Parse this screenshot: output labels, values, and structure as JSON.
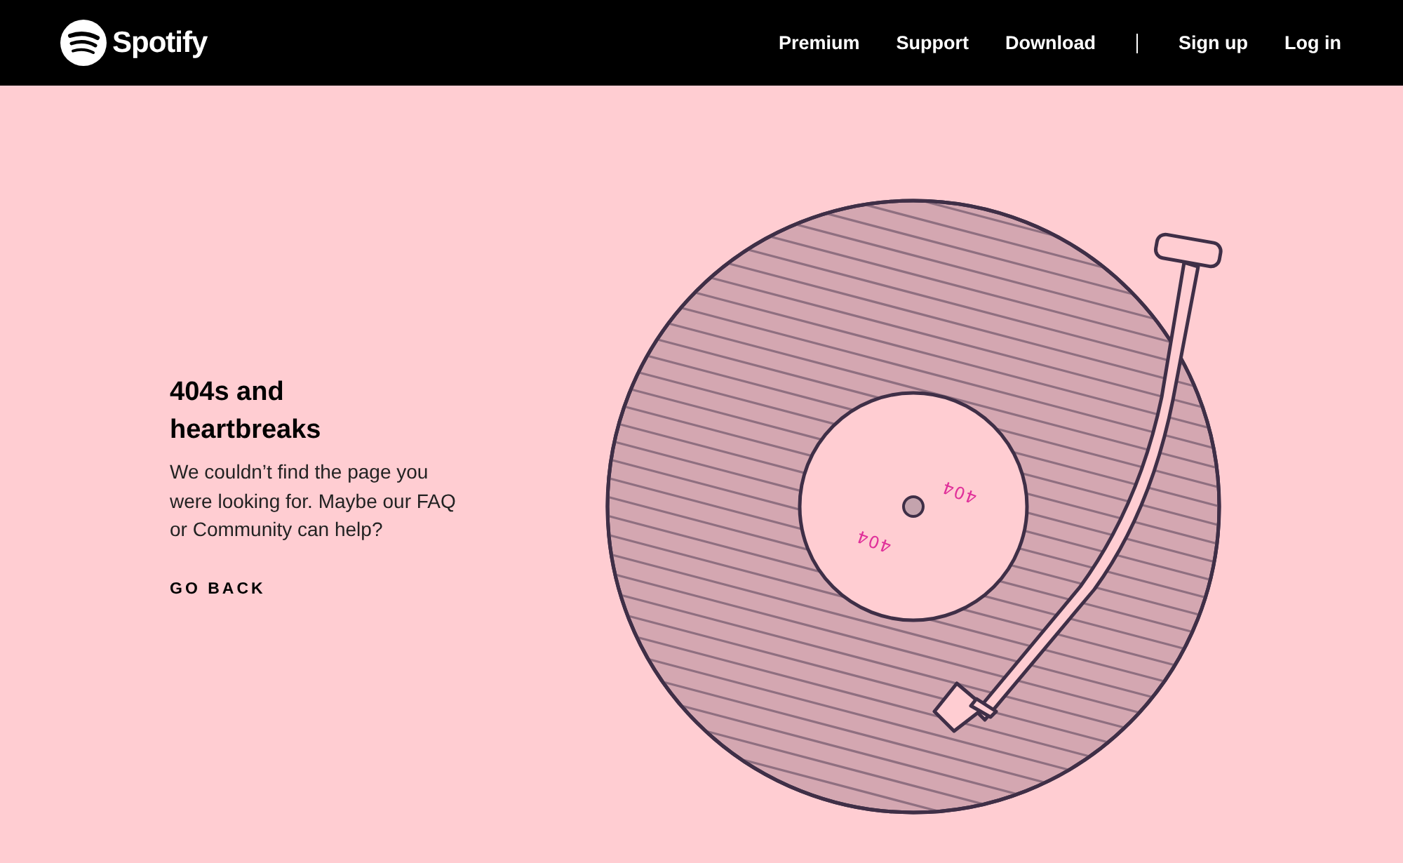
{
  "header": {
    "logo_text": "Spotify",
    "nav": [
      {
        "label": "Premium",
        "kind": "link"
      },
      {
        "label": "Support",
        "kind": "link"
      },
      {
        "label": "Download",
        "kind": "link"
      },
      {
        "kind": "divider"
      },
      {
        "label": "Sign up",
        "kind": "link"
      },
      {
        "label": "Log in",
        "kind": "link"
      }
    ]
  },
  "error": {
    "title": "404s and heartbreaks",
    "message": "We couldn’t find the page you were looking for. Maybe our FAQ or Community can help?",
    "link": "GO BACK"
  },
  "record": {
    "labels": [
      "404",
      "404"
    ]
  }
}
